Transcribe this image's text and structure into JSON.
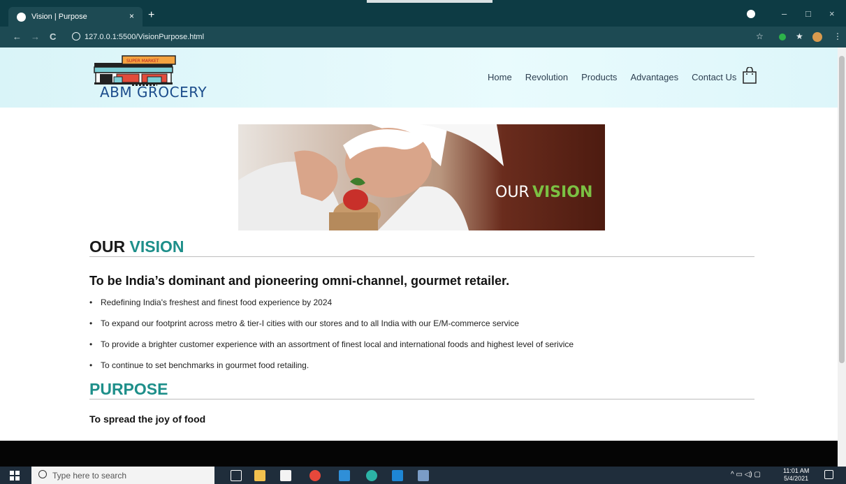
{
  "browser": {
    "tab_title": "Vision | Purpose",
    "tab_close": "×",
    "new_tab": "+",
    "url": "127.0.0.1:5500/VisionPurpose.html",
    "nav": {
      "back": "←",
      "forward": "→",
      "reload": "C"
    },
    "window": {
      "minimize": "–",
      "maximize": "□",
      "close": "×"
    }
  },
  "header": {
    "logo_text": "ABM GROCERY",
    "logo_sign": "SUPER MARKET",
    "nav_items": [
      "Home",
      "Revolution",
      "Products",
      "Advantages",
      "Contact Us"
    ],
    "cart_icon": "shopping-bag-icon"
  },
  "hero": {
    "word_our": "OUR ",
    "word_vision": "VISION",
    "accent_color": "#7bc043"
  },
  "vision": {
    "heading_our": "OUR ",
    "heading_vision": "VISION",
    "tagline": "To be India’s dominant and pioneering omni-channel, gourmet retailer.",
    "points": [
      "Redefining India's freshest and finest food experience by 2024",
      "To expand our footprint across metro & tier-I cities with our stores and to all India with our E/M-commerce service",
      "To provide a brighter customer experience with an assortment of finest local and international foods and highest level of serivice",
      "To continue to set benchmarks in gourmet food retailing."
    ]
  },
  "purpose": {
    "heading": "PURPOSE",
    "text": "To spread the joy of food"
  },
  "colors": {
    "accent": "#1e8f8a",
    "header_bg": "#dcf5f8",
    "browser_chrome": "#0d3b44"
  },
  "taskbar": {
    "search_placeholder": "Type here to search",
    "time": "11:01 AM",
    "date": "5/4/2021"
  }
}
